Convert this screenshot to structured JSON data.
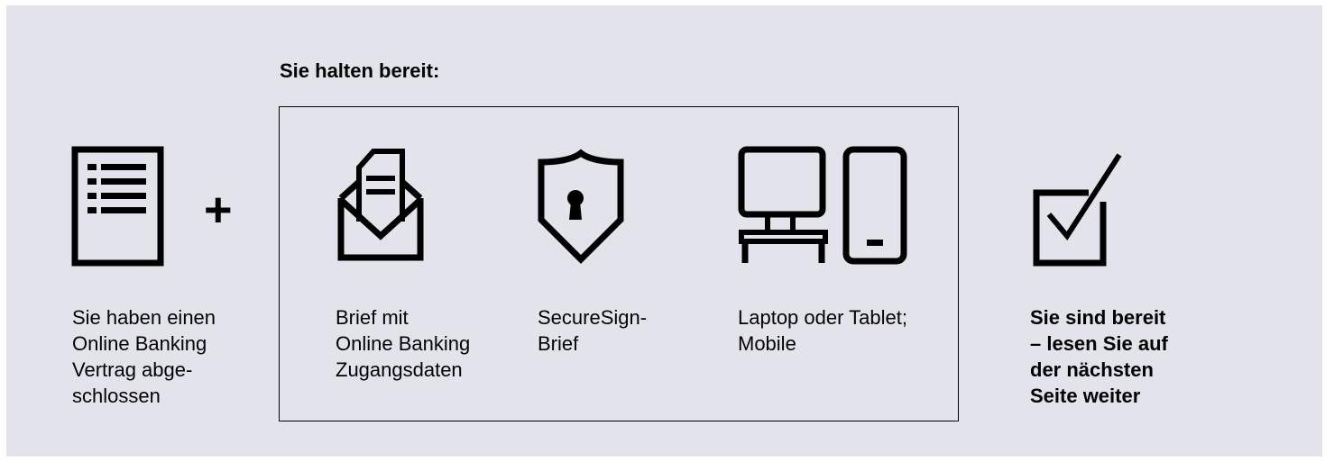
{
  "heading": "Sie halten bereit:",
  "plus": "+",
  "steps": [
    {
      "icon": "contract-document-icon",
      "caption": "Sie haben einen\nOnline Banking\nVertrag abge-\nschlossen"
    },
    {
      "icon": "letter-envelope-icon",
      "caption": "Brief mit\nOnline Banking\nZugangsdaten"
    },
    {
      "icon": "securesign-shield-icon",
      "caption": "SecureSign-\nBrief"
    },
    {
      "icon": "computer-and-mobile-icon",
      "caption": "Laptop oder Tablet;\nMobile"
    },
    {
      "icon": "checkbox-checked-icon",
      "caption": "Sie sind bereit\n– lesen Sie auf\nder nächsten\nSeite weiter"
    }
  ],
  "colors": {
    "background": "#e3e3ec",
    "ink": "#000000"
  }
}
